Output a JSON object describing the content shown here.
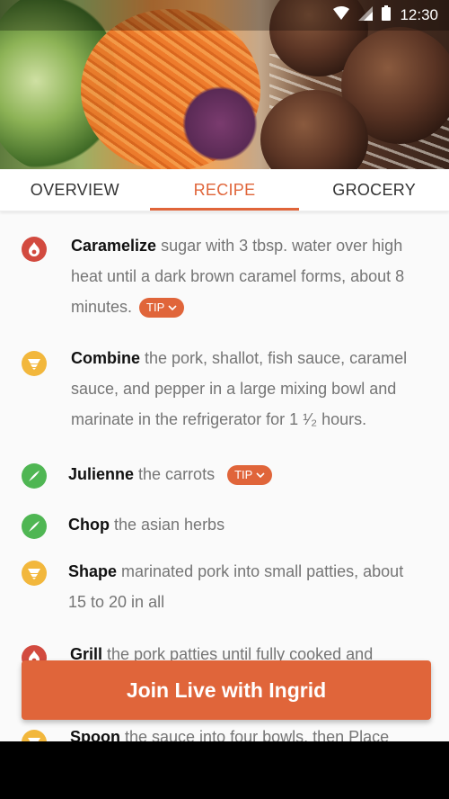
{
  "status_bar": {
    "time": "12:30"
  },
  "tabs": [
    {
      "label": "OVERVIEW"
    },
    {
      "label": "RECIPE"
    },
    {
      "label": "GROCERY"
    }
  ],
  "steps": [
    {
      "action": "Caramelize",
      "rest": " sugar with 3 tbsp. water over high heat until a dark brown caramel forms, about 8 minutes.",
      "icon": "flame-icon",
      "tip": "TIP"
    },
    {
      "action": "Combine",
      "rest": " the pork, shallot, fish sauce, caramel sauce, and pepper in a large mixing bowl and marinate in the refrigerator for 1 ¹⁄₂ hours.",
      "icon": "bowl-icon"
    },
    {
      "action": "Julienne",
      "rest": " the carrots",
      "icon": "knife-icon",
      "tip": "TIP"
    },
    {
      "action": "Chop",
      "rest": " the asian herbs",
      "icon": "knife-icon"
    },
    {
      "action": "Shape",
      "rest": " marinated pork into small patties, about 15 to 20 in all",
      "icon": "bowl-icon"
    },
    {
      "action": "Grill",
      "rest": " the pork patties until fully cooked and",
      "icon": "flame-icon"
    },
    {
      "action": "Spoon",
      "rest": " the sauce into four bowls, then Place",
      "icon": "bowl-icon"
    }
  ],
  "cta": {
    "label": "Join Live with Ingrid"
  },
  "colors": {
    "accent": "#e0653a",
    "flame": "#d24a3f",
    "bowl": "#f2b73c",
    "knife": "#4fb653"
  }
}
